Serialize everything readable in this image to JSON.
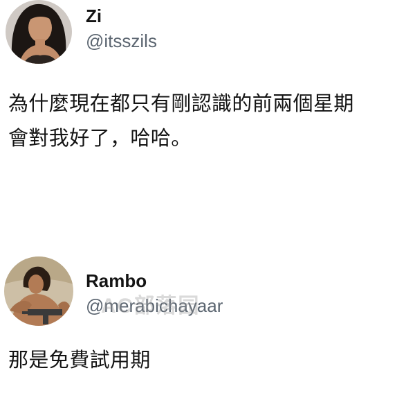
{
  "tweets": [
    {
      "display_name": "Zi",
      "handle": "@itsszils",
      "avatar_icon": "user-avatar-woman",
      "text_lines": [
        "為什麼現在都只有剛認識的前兩個星期",
        "會對我好了，哈哈。"
      ]
    },
    {
      "display_name": "Rambo",
      "handle": "@merabichayaar",
      "avatar_icon": "user-avatar-man",
      "text_lines": [
        "那是免費試用期"
      ]
    }
  ],
  "watermark": "AC部落园"
}
